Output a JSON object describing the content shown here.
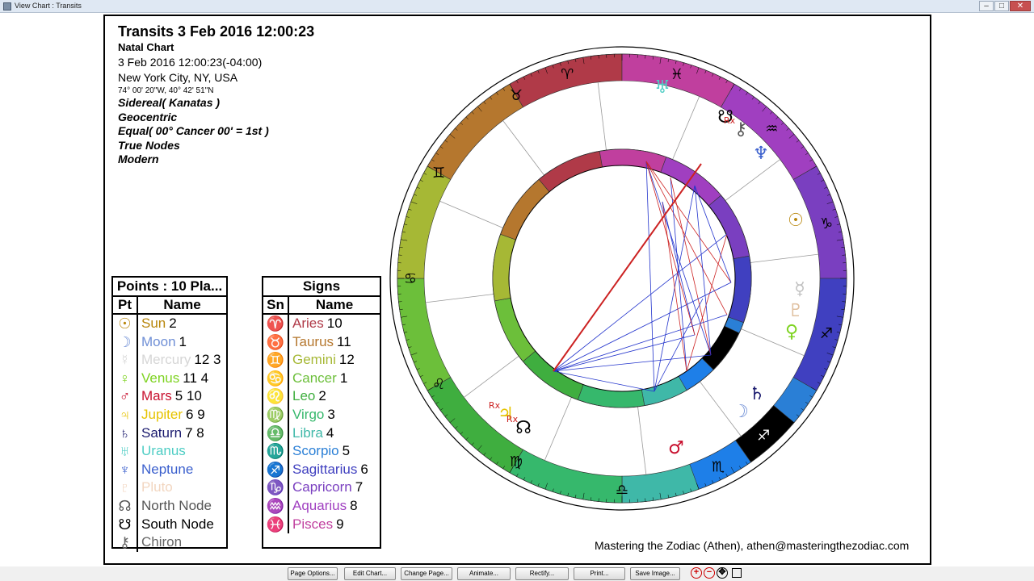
{
  "window": {
    "title": "View Chart : Transits",
    "min": "–",
    "max": "□",
    "close": "✕"
  },
  "header": {
    "title": "Transits 3 Feb 2016 12:00:23",
    "chart_type": "Natal Chart",
    "datetime": "3 Feb 2016 12:00:23(-04:00)",
    "place": "New York City, NY, USA",
    "coords": "74° 00' 20\"W, 40° 42' 51\"N",
    "zodiac": "Sidereal( Kanatas )",
    "centric": "Geocentric",
    "houses": "Equal( 00° Cancer 00' = 1st )",
    "nodes": "True Nodes",
    "style": "Modern"
  },
  "points_table": {
    "caption": "Points : 10 Pla...",
    "col_pt": "Pt",
    "col_name": "Name",
    "rows": [
      {
        "glyph": "☉",
        "name": "Sun",
        "nums": "2",
        "color": "#b8860b"
      },
      {
        "glyph": "☽",
        "name": "Moon",
        "nums": "1",
        "color": "#6f8fd6"
      },
      {
        "glyph": "☿",
        "name": "Mercury",
        "nums": "12 3",
        "color": "#d6d6d6"
      },
      {
        "glyph": "♀",
        "name": "Venus",
        "nums": "11 4",
        "color": "#7ed321"
      },
      {
        "glyph": "♂",
        "name": "Mars",
        "nums": "5 10",
        "color": "#c8102e"
      },
      {
        "glyph": "♃",
        "name": "Jupiter",
        "nums": "6 9",
        "color": "#e6c300"
      },
      {
        "glyph": "♄",
        "name": "Saturn",
        "nums": "7 8",
        "color": "#1a1a6e"
      },
      {
        "glyph": "♅",
        "name": "Uranus",
        "nums": "",
        "color": "#4ecdc4"
      },
      {
        "glyph": "♆",
        "name": "Neptune",
        "nums": "",
        "color": "#3a5fcd"
      },
      {
        "glyph": "♇",
        "name": "Pluto",
        "nums": "",
        "color": "#f2d6c0"
      },
      {
        "glyph": "☊",
        "name": "North Node",
        "nums": "",
        "color": "#555555"
      },
      {
        "glyph": "☋",
        "name": "South Node",
        "nums": "",
        "color": "#000000"
      },
      {
        "glyph": "⚷",
        "name": "Chiron",
        "nums": "",
        "color": "#666666"
      }
    ]
  },
  "signs_table": {
    "caption": "Signs",
    "col_sn": "Sn",
    "col_name": "Name",
    "rows": [
      {
        "glyph": "♈",
        "name": "Aries",
        "num": "10",
        "color": "#b03a48"
      },
      {
        "glyph": "♉",
        "name": "Taurus",
        "num": "11",
        "color": "#b5772e"
      },
      {
        "glyph": "♊",
        "name": "Gemini",
        "num": "12",
        "color": "#a6b835"
      },
      {
        "glyph": "♋",
        "name": "Cancer",
        "num": "1",
        "color": "#6cbf3a"
      },
      {
        "glyph": "♌",
        "name": "Leo",
        "num": "2",
        "color": "#3fae3f"
      },
      {
        "glyph": "♍",
        "name": "Virgo",
        "num": "3",
        "color": "#36b86c"
      },
      {
        "glyph": "♎",
        "name": "Libra",
        "num": "4",
        "color": "#3fb8a8"
      },
      {
        "glyph": "♏",
        "name": "Scorpio",
        "num": "5",
        "color": "#2a7fd6"
      },
      {
        "glyph": "♐",
        "name": "Sagittarius",
        "num": "6",
        "color": "#4040c0"
      },
      {
        "glyph": "♑",
        "name": "Capricorn",
        "num": "7",
        "color": "#7a3fc0"
      },
      {
        "glyph": "♒",
        "name": "Aquarius",
        "num": "8",
        "color": "#a03fc0"
      },
      {
        "glyph": "♓",
        "name": "Pisces",
        "num": "9",
        "color": "#c03f9e"
      }
    ]
  },
  "wheel": {
    "outer_signs": [
      {
        "glyph": "♈",
        "color": "#b03a48"
      },
      {
        "glyph": "♓",
        "color": "#c03f9e"
      },
      {
        "glyph": "♒",
        "color": "#a03fc0"
      },
      {
        "glyph": "♑",
        "color": "#7a3fc0"
      },
      {
        "glyph": "♐",
        "color": "#4040c0"
      },
      {
        "glyph": "♐",
        "color": "#000000"
      },
      {
        "glyph": "♏",
        "color": "#2a7fd6"
      },
      {
        "glyph": "♎",
        "color": "#3fb8a8"
      },
      {
        "glyph": "♍",
        "color": "#36b86c"
      },
      {
        "glyph": "♌",
        "color": "#6cbf3a"
      },
      {
        "glyph": "♋",
        "color": "#8fc43a"
      },
      {
        "glyph": "♊",
        "color": "#a6b835"
      },
      {
        "glyph": "♉",
        "color": "#b5772e"
      }
    ],
    "planets": [
      {
        "glyph": "♅",
        "color": "#4ecdc4",
        "retro": ""
      },
      {
        "glyph": "☋",
        "color": "#000000",
        "retro": ""
      },
      {
        "glyph": "⚷",
        "color": "#555555",
        "retro": "Rx"
      },
      {
        "glyph": "♆",
        "color": "#3a5fcd",
        "retro": ""
      },
      {
        "glyph": "☉",
        "color": "#b8860b",
        "retro": ""
      },
      {
        "glyph": "☿",
        "color": "#c0c0c0",
        "retro": ""
      },
      {
        "glyph": "♇",
        "color": "#e0c0a0",
        "retro": ""
      },
      {
        "glyph": "♀",
        "color": "#7ed321",
        "retro": ""
      },
      {
        "glyph": "♄",
        "color": "#1a1a6e",
        "retro": ""
      },
      {
        "glyph": "☽",
        "color": "#6f8fd6",
        "retro": ""
      },
      {
        "glyph": "♂",
        "color": "#c8102e",
        "retro": ""
      },
      {
        "glyph": "♃",
        "color": "#e6c300",
        "retro": "Rx"
      },
      {
        "glyph": "☊",
        "color": "#000000",
        "retro": "Rx"
      }
    ]
  },
  "footer": "Mastering the Zodiac (Athen), athen@masteringthezodiac.com",
  "toolbar": {
    "page_options": "Page Options...",
    "edit_chart": "Edit Chart...",
    "change_page": "Change Page...",
    "animate": "Animate...",
    "rectify": "Rectify...",
    "print": "Print...",
    "save_image": "Save Image..."
  }
}
